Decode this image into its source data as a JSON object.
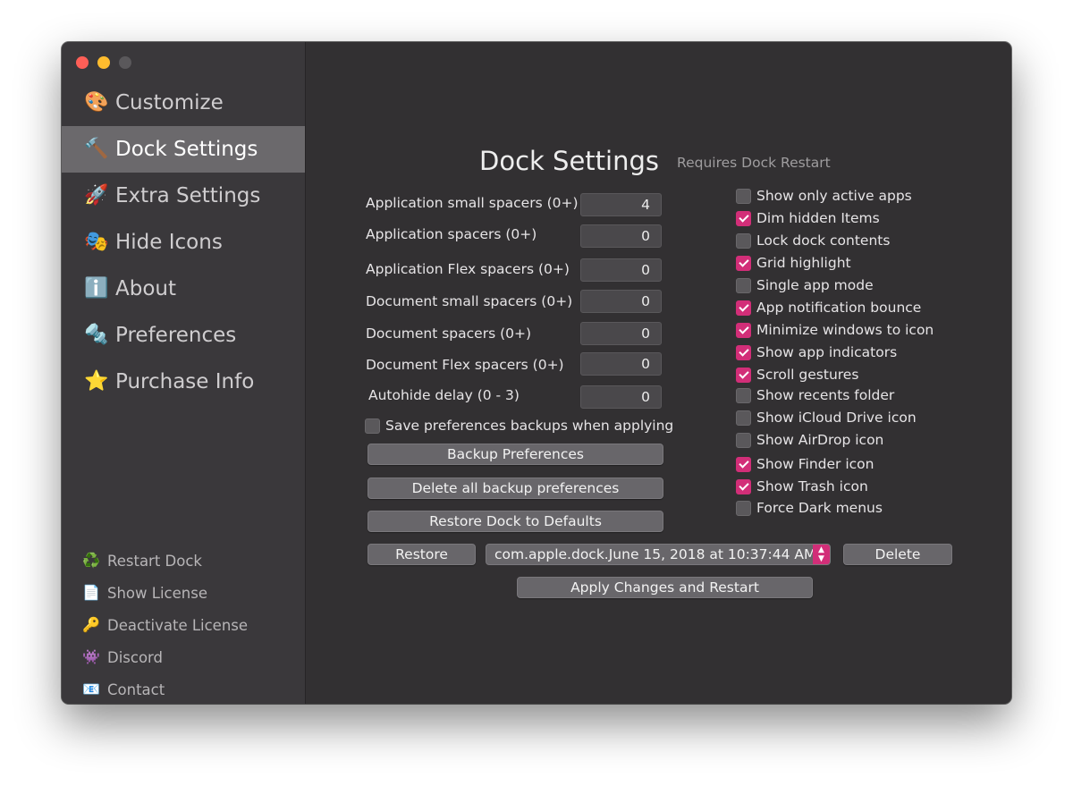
{
  "sidebar": {
    "items": [
      {
        "icon": "🎨",
        "icon_name": "palette-icon",
        "label": "Customize"
      },
      {
        "icon": "🔨",
        "icon_name": "hammer-icon",
        "label": "Dock Settings"
      },
      {
        "icon": "🚀",
        "icon_name": "rocket-icon",
        "label": "Extra Settings"
      },
      {
        "icon": "🎭",
        "icon_name": "masks-icon",
        "label": "Hide Icons"
      },
      {
        "icon": "ℹ️",
        "icon_name": "info-icon",
        "label": "About"
      },
      {
        "icon": "🔩",
        "icon_name": "bolt-icon",
        "label": "Preferences"
      },
      {
        "icon": "⭐",
        "icon_name": "star-icon",
        "label": "Purchase Info"
      }
    ],
    "bottom_items": [
      {
        "icon": "♻️",
        "icon_name": "recycle-icon",
        "label": "Restart Dock"
      },
      {
        "icon": "📄",
        "icon_name": "document-icon",
        "label": "Show License"
      },
      {
        "icon": "🔑",
        "icon_name": "key-icon",
        "label": "Deactivate License"
      },
      {
        "icon": "👾",
        "icon_name": "alien-icon",
        "label": "Discord"
      },
      {
        "icon": "📧",
        "icon_name": "email-icon",
        "label": "Contact"
      }
    ]
  },
  "main": {
    "title": "Dock Settings",
    "restart_note": "Requires Dock Restart",
    "fields": [
      {
        "label": "Application small spacers (0+)",
        "value": "4"
      },
      {
        "label": "Application spacers (0+)",
        "value": "0"
      },
      {
        "label": "Application Flex spacers (0+)",
        "value": "0"
      },
      {
        "label": "Document small spacers (0+)",
        "value": "0"
      },
      {
        "label": "Document spacers (0+)",
        "value": "0"
      },
      {
        "label": "Document Flex spacers (0+)",
        "value": "0"
      },
      {
        "label": "Autohide delay (0 - 3)",
        "value": "0"
      }
    ],
    "save_backups_label": "Save preferences backups when applying",
    "buttons": {
      "backup": "Backup Preferences",
      "delete_all": "Delete all backup preferences",
      "restore_defaults": "Restore Dock to Defaults",
      "restore": "Restore",
      "delete": "Delete",
      "apply": "Apply Changes and Restart"
    },
    "backup_select_value": "com.apple.dock.June 15, 2018 at 10:37:44 AM...",
    "checkboxes": [
      {
        "label": "Show only active apps",
        "checked": false
      },
      {
        "label": "Dim hidden Items",
        "checked": true
      },
      {
        "label": "Lock dock contents",
        "checked": false
      },
      {
        "label": "Grid highlight",
        "checked": true
      },
      {
        "label": "Single app mode",
        "checked": false
      },
      {
        "label": "App notification bounce",
        "checked": true
      },
      {
        "label": "Minimize windows to icon",
        "checked": true
      },
      {
        "label": "Show app indicators",
        "checked": true
      },
      {
        "label": "Scroll gestures",
        "checked": true
      },
      {
        "label": "Show recents folder",
        "checked": false
      },
      {
        "label": "Show iCloud Drive icon",
        "checked": false
      },
      {
        "label": "Show AirDrop icon",
        "checked": false
      },
      {
        "label": "Show Finder icon",
        "checked": true
      },
      {
        "label": "Show Trash icon",
        "checked": true
      },
      {
        "label": "Force Dark menus",
        "checked": false
      }
    ]
  },
  "colors": {
    "accent": "#d22e78",
    "sidebar_bg": "#3a383b",
    "content_bg": "#323032",
    "selected_item": "#6b696c"
  }
}
